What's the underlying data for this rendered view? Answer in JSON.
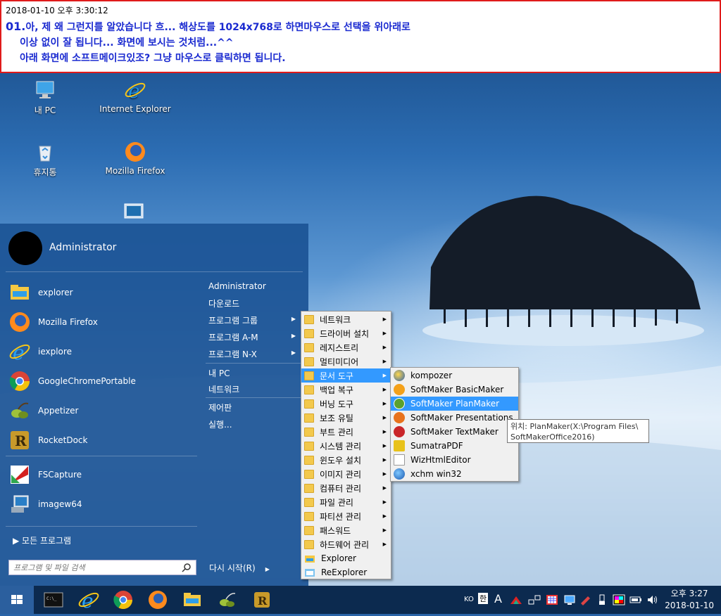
{
  "note": {
    "timestamp": "2018-01-10 오후 3:30:12",
    "line1_num": "01.",
    "line1": "아, 제 왜 그런지를 알았습니다 흐...  해상도를 1024x768로 하면마우스로 선택을 위아래로",
    "line2": "이상 없이 잘 됩니다... 화면에 보시는 것처럼...^^",
    "line3": "아래 화면에 소프트메이크있조? 그냥 마우스로 클릭하면 됩니다."
  },
  "desktop_icons": [
    {
      "label": "내 PC",
      "icon": "monitor-icon"
    },
    {
      "label": "Internet Explorer",
      "icon": "ie-icon"
    },
    {
      "label": "휴지통",
      "icon": "recycle-bin-icon"
    },
    {
      "label": "Mozilla Firefox",
      "icon": "firefox-icon"
    }
  ],
  "start_menu": {
    "user": "Administrator",
    "apps": [
      "explorer",
      "Mozilla Firefox",
      "iexplore",
      "GoogleChromePortable",
      "Appetizer",
      "RocketDock",
      "FSCapture",
      "imagew64"
    ],
    "right": [
      "Administrator",
      "다운로드",
      "프로그램 그룹",
      "프로그램 A-M",
      "프로그램 N-X",
      "내 PC",
      "네트워크",
      "제어판",
      "실행..."
    ],
    "all_programs": "모든 프로그램",
    "search_placeholder": "프로그램 및 파일 검색",
    "restart": "다시 시작(R)"
  },
  "group_menu": [
    "네트워크",
    "드라이버 설치",
    "레지스트리",
    "멀티미디어",
    "문서 도구",
    "백업 복구",
    "버닝 도구",
    "보조 유틸",
    "부트 관리",
    "시스템 관리",
    "윈도우 설치",
    "이미지 관리",
    "컴퓨터 관리",
    "파일 관리",
    "파티션 관리",
    "패스워드",
    "하드웨어 관리",
    "Explorer",
    "ReExplorer"
  ],
  "doc_menu": [
    "kompozer",
    "SoftMaker BasicMaker",
    "SoftMaker PlanMaker",
    "SoftMaker Presentations",
    "SoftMaker TextMaker",
    "SumatraPDF",
    "WizHtmlEditor",
    "xchm win32"
  ],
  "tooltip": {
    "line1": "위치: PlanMaker(X:\\Program Files\\",
    "line2": "SoftMakerOffice2016)"
  },
  "tray": {
    "lang": "KO",
    "ime": "한",
    "font": "A",
    "time": "오후 3:27",
    "date": "2018-01-10"
  },
  "colors": {
    "note_border": "#e01b1b",
    "note_text": "#1a2ad0",
    "highlight": "#3399ff",
    "start_bg": "#1c5496",
    "taskbar": "#0c2a4f"
  }
}
